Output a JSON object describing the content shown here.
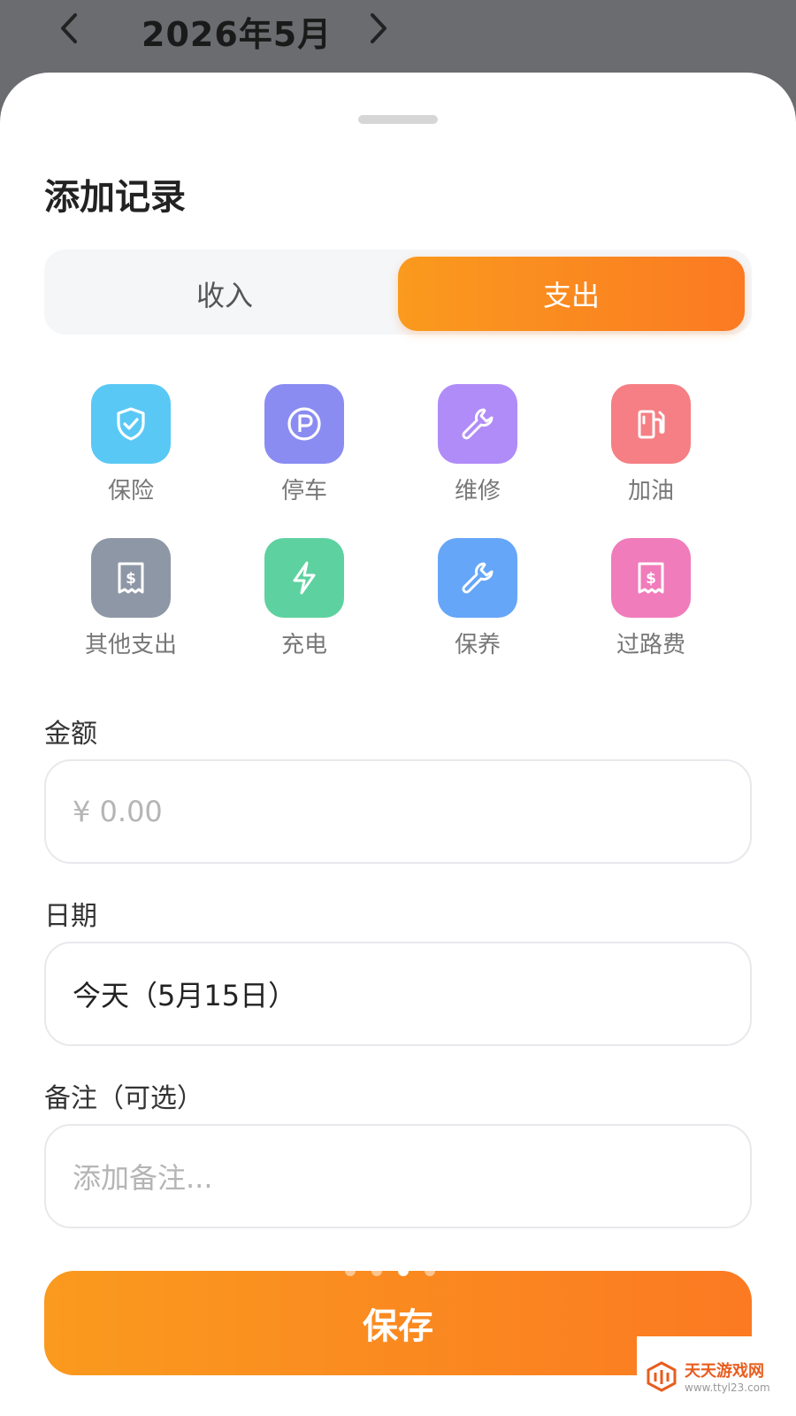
{
  "header": {
    "month": "2026年5月",
    "prev_icon": "chevron-left-icon",
    "next_icon": "chevron-right-icon"
  },
  "sheet": {
    "title": "添加记录",
    "tabs": [
      {
        "label": "收入",
        "selected": false
      },
      {
        "label": "支出",
        "selected": true
      }
    ],
    "categories": [
      {
        "label": "保险",
        "icon": "shield-check-icon",
        "color": "#5ac8f5"
      },
      {
        "label": "停车",
        "icon": "parking-icon",
        "color": "#8a8cf2"
      },
      {
        "label": "维修",
        "icon": "wrench-icon",
        "color": "#b08cf8"
      },
      {
        "label": "加油",
        "icon": "fuel-pump-icon",
        "color": "#f57f84"
      },
      {
        "label": "其他支出",
        "icon": "receipt-dollar-icon",
        "color": "#8e97a6"
      },
      {
        "label": "充电",
        "icon": "lightning-icon",
        "color": "#5ed1a0"
      },
      {
        "label": "保养",
        "icon": "wrench-icon",
        "color": "#66a6f8"
      },
      {
        "label": "过路费",
        "icon": "receipt-dollar-icon",
        "color": "#f07cbb"
      }
    ],
    "amount": {
      "label": "金额",
      "placeholder": "¥ 0.00"
    },
    "date": {
      "label": "日期",
      "value": "今天（5月15日）"
    },
    "note": {
      "label": "备注（可选）",
      "placeholder": "添加备注..."
    },
    "save_label": "保存",
    "page_dots": {
      "count": 4,
      "active_index": 2
    }
  },
  "watermark": {
    "name": "天天游戏网",
    "url": "www.ttyl23.com"
  },
  "colors": {
    "accent": "#fa8a1f",
    "background_dim": "#6b6c70"
  }
}
